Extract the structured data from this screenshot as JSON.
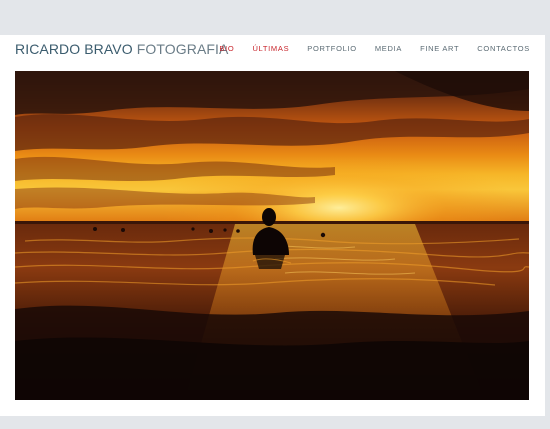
{
  "brand": {
    "name": "RICARDO BRAVO",
    "tagline": "FOTOGRAFIA"
  },
  "nav": {
    "items": [
      {
        "label": "BIO",
        "active": true
      },
      {
        "label": "ÚLTIMAS",
        "active": true
      },
      {
        "label": "PORTFOLIO",
        "active": false
      },
      {
        "label": "MEDIA",
        "active": false
      },
      {
        "label": "FINE ART",
        "active": false
      },
      {
        "label": "CONTACTOS",
        "active": false
      }
    ]
  },
  "colors": {
    "accent": "#c8242b",
    "brand": "#3b5c6e",
    "nav": "#5a6a73",
    "background": "#e3e6ea"
  }
}
